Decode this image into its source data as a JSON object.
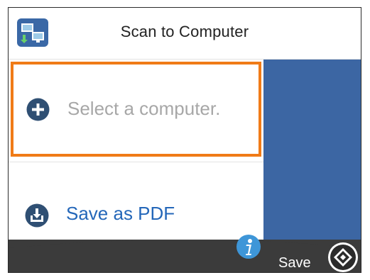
{
  "header": {
    "title": "Scan to Computer",
    "icon": "scan-to-computer-icon"
  },
  "list": {
    "items": [
      {
        "label": "Select a computer.",
        "icon": "plus-circle-icon",
        "selected": true
      },
      {
        "label": "Save as PDF",
        "icon": "save-tray-icon",
        "selected": false
      }
    ]
  },
  "footer": {
    "save_label": "Save",
    "start_icon": "start-diamond-icon",
    "info_icon": "info-icon"
  },
  "colors": {
    "accent_orange": "#f07b17",
    "panel_blue": "#3c66a3",
    "link_blue": "#2467b9",
    "icon_navy": "#2f4f73",
    "info_blue": "#3e96d8",
    "bar_dark": "#3b3b3b"
  }
}
